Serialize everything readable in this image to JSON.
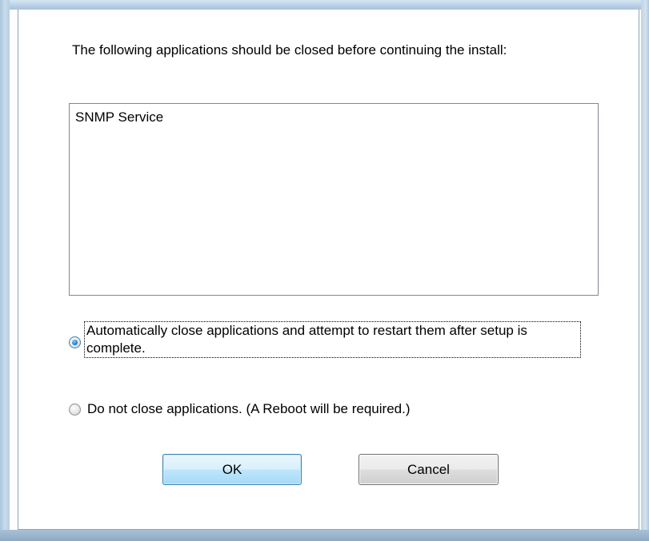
{
  "dialog": {
    "message": "The following applications should be closed before continuing the install:",
    "applications": [
      "SNMP Service"
    ],
    "options": [
      {
        "label": "Automatically close applications and attempt to restart them after setup is complete.",
        "checked": true
      },
      {
        "label": "Do not close applications. (A Reboot will be required.)",
        "checked": false
      }
    ],
    "buttons": {
      "ok_label": "OK",
      "cancel_label": "Cancel"
    }
  },
  "colors": {
    "frame": "#b8d0e6",
    "ok_border": "#3c7fb1",
    "radio_fill": "#1b80d6"
  }
}
